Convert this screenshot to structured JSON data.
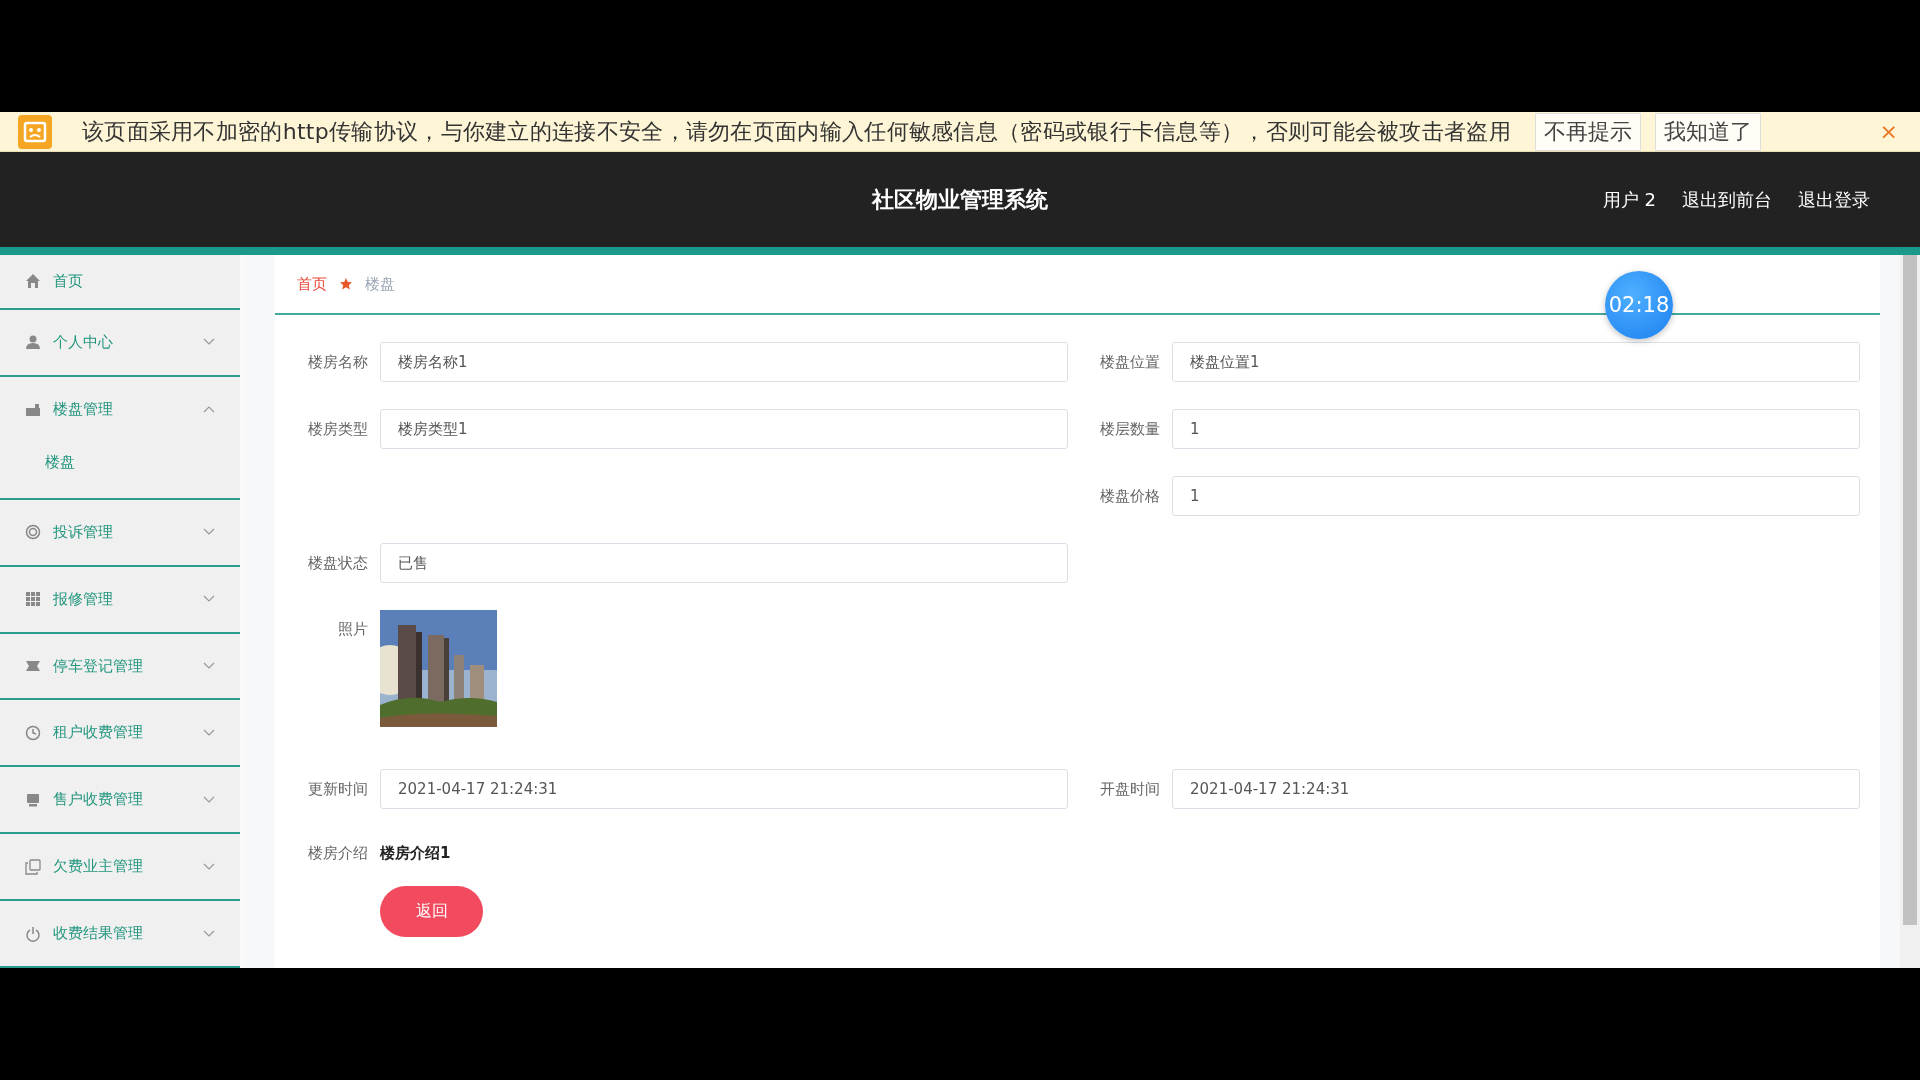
{
  "security_bar": {
    "message": "该页面采用不加密的http传输协议，与你建立的连接不安全，请勿在页面内输入任何敏感信息（密码或银行卡信息等），否则可能会被攻击者盗用",
    "buttons": [
      "不再提示",
      "我知道了"
    ],
    "close": "×"
  },
  "header": {
    "title": "社区物业管理系统",
    "links": [
      "用户 2",
      "退出到前台",
      "退出登录"
    ]
  },
  "sidebar": {
    "items": [
      {
        "label": "首页",
        "kind": "link"
      },
      {
        "label": "个人中心",
        "kind": "group",
        "expanded": false
      },
      {
        "label": "楼盘管理",
        "kind": "group",
        "expanded": true,
        "children": [
          {
            "label": "楼盘"
          }
        ]
      },
      {
        "label": "投诉管理",
        "kind": "group",
        "expanded": false
      },
      {
        "label": "报修管理",
        "kind": "group",
        "expanded": false
      },
      {
        "label": "停车登记管理",
        "kind": "group",
        "expanded": false
      },
      {
        "label": "租户收费管理",
        "kind": "group",
        "expanded": false
      },
      {
        "label": "售户收费管理",
        "kind": "group",
        "expanded": false
      },
      {
        "label": "欠费业主管理",
        "kind": "group",
        "expanded": false
      },
      {
        "label": "收费结果管理",
        "kind": "group",
        "expanded": false
      }
    ]
  },
  "breadcrumb": [
    "首页",
    "楼盘"
  ],
  "timer": "02:18",
  "form": {
    "rows": [
      {
        "left": {
          "label": "楼房名称",
          "value": "楼房名称1"
        },
        "right": {
          "label": "楼盘位置",
          "value": "楼盘位置1"
        }
      },
      {
        "left": {
          "label": "楼房类型",
          "value": "楼房类型1"
        },
        "right": {
          "label": "楼层数量",
          "value": "1"
        }
      },
      {
        "right": {
          "label": "楼盘价格",
          "value": "1"
        }
      },
      {
        "left": {
          "label": "楼盘状态",
          "value": "已售"
        }
      }
    ],
    "photo": {
      "label": "照片",
      "kind": "picture"
    },
    "dates": {
      "left": {
        "label": "更新时间",
        "value": "2021-04-17 21:24:31"
      },
      "right": {
        "label": "开盘时间",
        "value": "2021-04-17 21:24:31"
      }
    },
    "intro": {
      "label": "楼房介绍",
      "value": "楼房介绍1"
    },
    "back_button": "返回"
  }
}
